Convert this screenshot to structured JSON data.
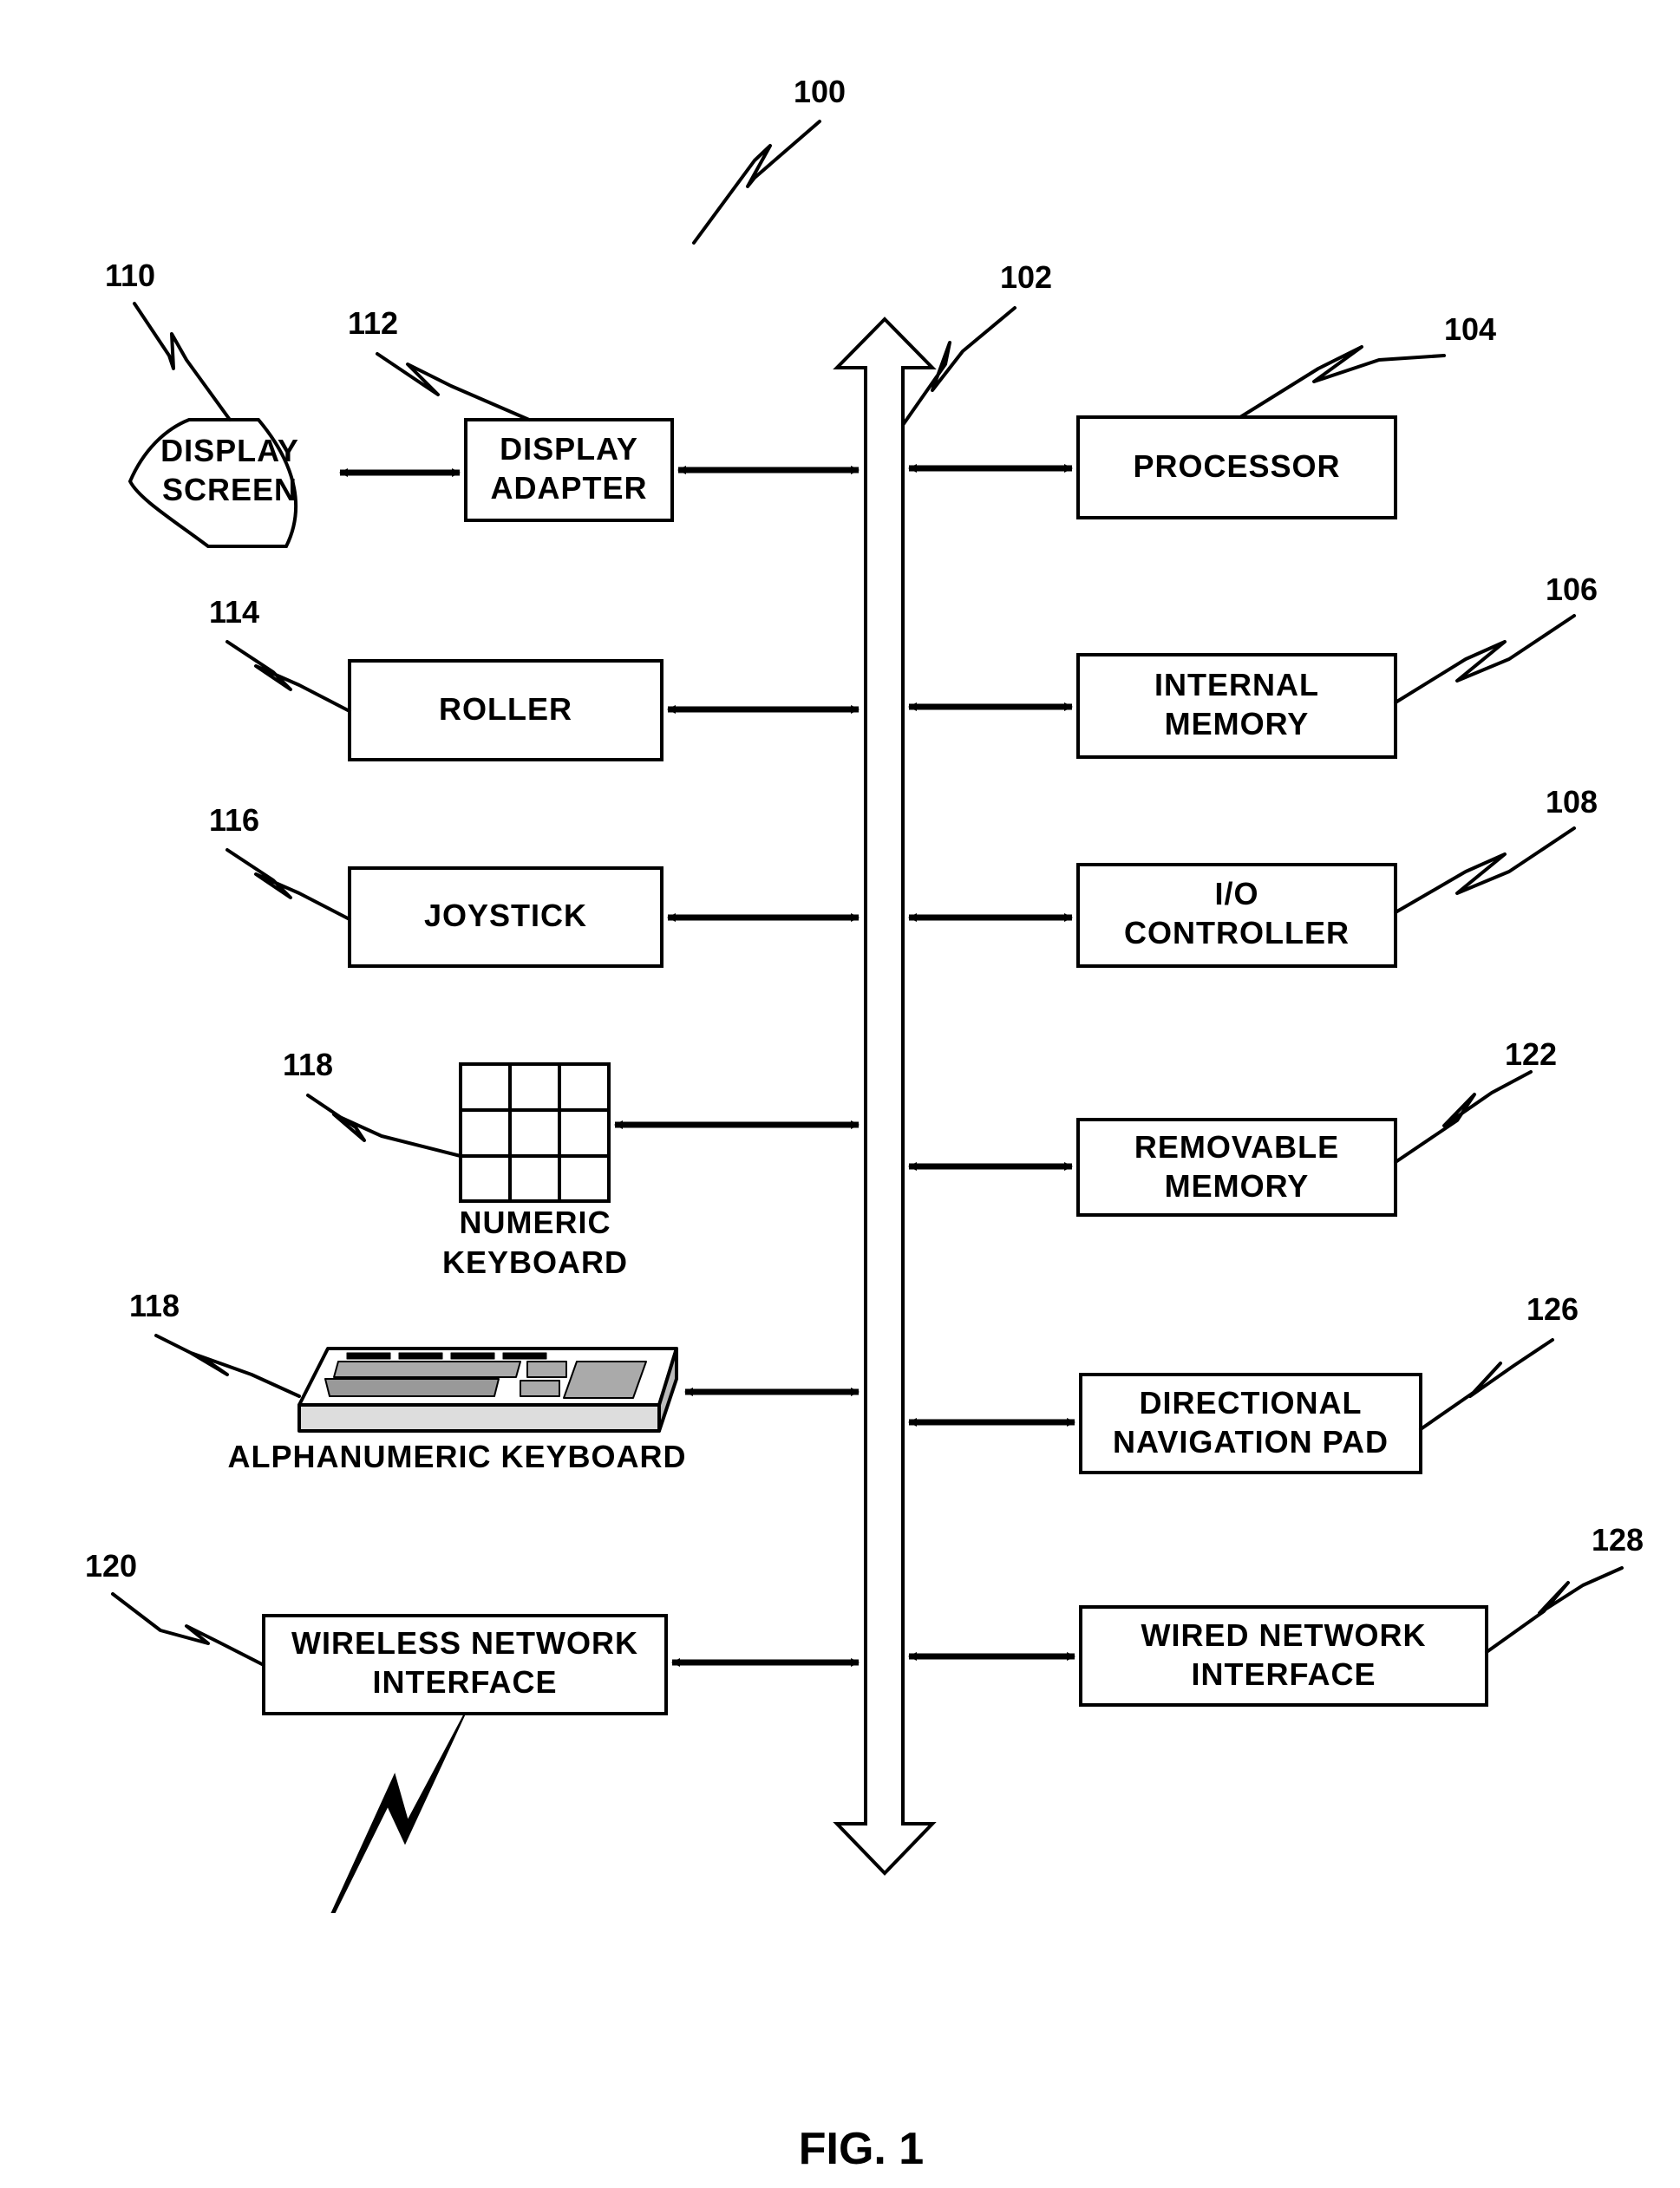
{
  "figure": {
    "caption": "FIG. 1",
    "system_ref": "100",
    "bus_ref": "102"
  },
  "components": {
    "display_screen": {
      "ref": "110",
      "lines": [
        "DISPLAY",
        "SCREEN"
      ]
    },
    "display_adapter": {
      "ref": "112",
      "lines": [
        "DISPLAY",
        "ADAPTER"
      ]
    },
    "processor": {
      "ref": "104",
      "lines": [
        "PROCESSOR"
      ]
    },
    "roller": {
      "ref": "114",
      "lines": [
        "ROLLER"
      ]
    },
    "internal_memory": {
      "ref": "106",
      "lines": [
        "INTERNAL",
        "MEMORY"
      ]
    },
    "joystick": {
      "ref": "116",
      "lines": [
        "JOYSTICK"
      ]
    },
    "io_controller": {
      "ref": "108",
      "lines": [
        "I/O",
        "CONTROLLER"
      ]
    },
    "numeric_keyboard": {
      "ref": "118",
      "lines": [
        "NUMERIC",
        "KEYBOARD"
      ]
    },
    "removable_memory": {
      "ref": "122",
      "lines": [
        "REMOVABLE",
        "MEMORY"
      ]
    },
    "alphanumeric_keyboard": {
      "ref": "118",
      "lines": [
        "ALPHANUMERIC KEYBOARD"
      ]
    },
    "directional_nav_pad": {
      "ref": "126",
      "lines": [
        "DIRECTIONAL",
        "NAVIGATION PAD"
      ]
    },
    "wireless_network_interface": {
      "ref": "120",
      "lines": [
        "WIRELESS NETWORK",
        "INTERFACE"
      ]
    },
    "wired_network_interface": {
      "ref": "128",
      "lines": [
        "WIRED NETWORK",
        "INTERFACE"
      ]
    }
  }
}
